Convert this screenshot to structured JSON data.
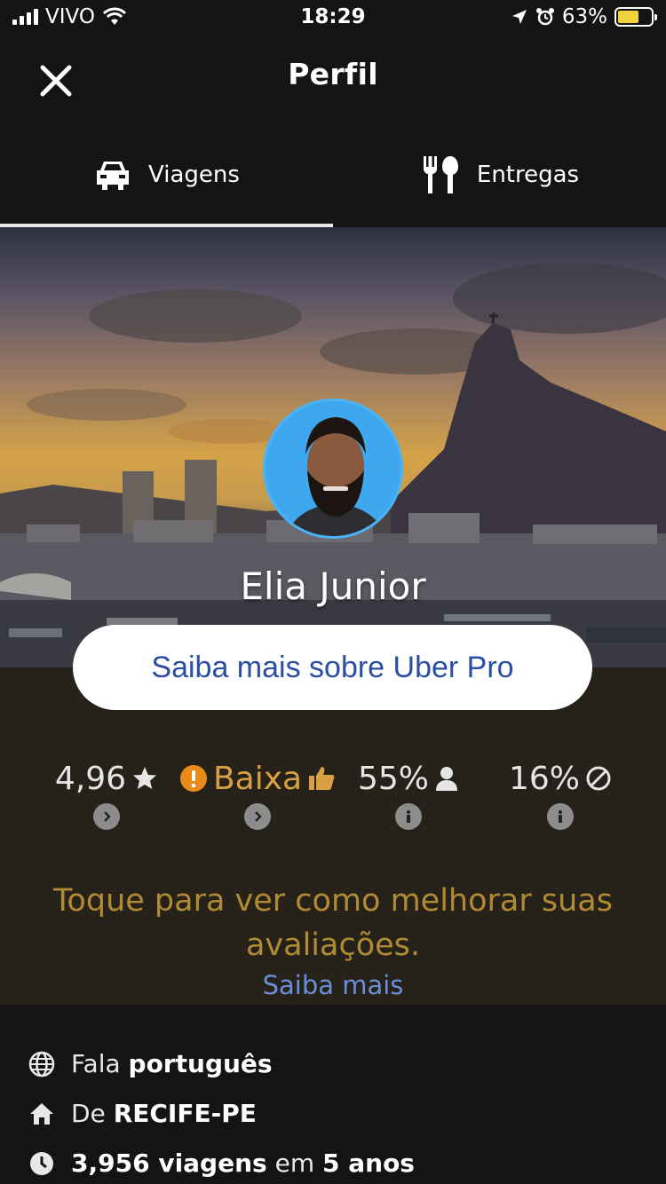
{
  "status_bar": {
    "carrier": "VIVO",
    "time": "18:29",
    "battery": "63%",
    "battery_level": 0.63
  },
  "header": {
    "title": "Perfil",
    "close_icon": "close-icon"
  },
  "tabs": [
    {
      "label": "Viagens",
      "icon": "car-icon",
      "active": true
    },
    {
      "label": "Entregas",
      "icon": "fork-spoon-icon",
      "active": false
    }
  ],
  "profile": {
    "name": "Elia Junior",
    "pro_button": "Saiba mais sobre Uber Pro"
  },
  "stats": [
    {
      "value": "4,96",
      "icon": "star-icon",
      "badge": "chevron-right-icon"
    },
    {
      "value": "Baixa",
      "icon": "thumbs-up-icon",
      "prefix_icon": "warning-icon",
      "badge": "chevron-right-icon"
    },
    {
      "value": "55%",
      "icon": "person-icon",
      "badge": "info-icon"
    },
    {
      "value": "16%",
      "icon": "cancel-icon",
      "badge": "info-icon"
    }
  ],
  "tip": {
    "text": "Toque para ver como melhorar suas avaliações.",
    "link": "Saiba mais"
  },
  "info": {
    "language_prefix": "Fala ",
    "language": "português",
    "origin_prefix": "De ",
    "origin": "RECIFE-PE",
    "trips": "3,956 viagens",
    "trips_mid": " em ",
    "years": "5 anos"
  },
  "colors": {
    "accent_blue": "#2b4ea4",
    "warning_orange": "#e98a1a",
    "tip_gold": "#b08a34",
    "link_blue": "#6a8fd9"
  }
}
